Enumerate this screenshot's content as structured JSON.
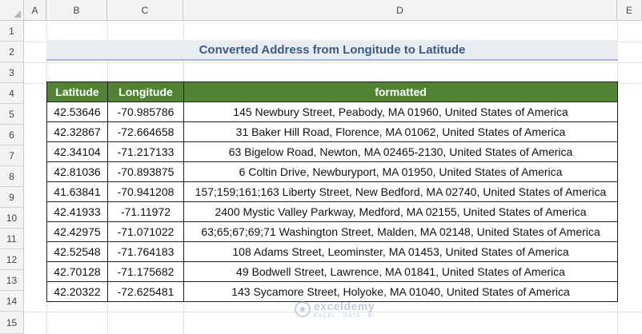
{
  "columns": [
    "A",
    "B",
    "C",
    "D",
    "E"
  ],
  "rows": [
    "1",
    "2",
    "3",
    "4",
    "5",
    "6",
    "7",
    "8",
    "9",
    "10",
    "11",
    "12",
    "13",
    "14",
    "15"
  ],
  "title": "Converted Address from Longitude to Latitude",
  "table": {
    "headers": [
      "Latitude",
      "Longitude",
      "formatted"
    ],
    "rows": [
      [
        "42.53646",
        "-70.985786",
        "145 Newbury Street, Peabody, MA 01960, United States of America"
      ],
      [
        "42.32867",
        "-72.664658",
        "31 Baker Hill Road, Florence, MA 01062, United States of America"
      ],
      [
        "42.34104",
        "-71.217133",
        "63 Bigelow Road, Newton, MA 02465-2130, United States of America"
      ],
      [
        "42.81036",
        "-70.893875",
        "6 Coltin Drive, Newburyport, MA 01950, United States of America"
      ],
      [
        "41.63841",
        "-70.941208",
        "157;159;161;163 Liberty Street, New Bedford, MA 02740, United States of America"
      ],
      [
        "42.41933",
        "-71.11972",
        "2400 Mystic Valley Parkway, Medford, MA 02155, United States of America"
      ],
      [
        "42.42975",
        "-71.071022",
        "63;65;67;69;71 Washington Street, Malden, MA 02148, United States of America"
      ],
      [
        "42.52548",
        "-71.764183",
        "108 Adams Street, Leominster, MA 01453, United States of America"
      ],
      [
        "42.70128",
        "-71.175682",
        "49 Bodwell Street, Lawrence, MA 01841, United States of America"
      ],
      [
        "42.20322",
        "-72.625481",
        "143 Sycamore Street, Holyoke, MA 01040, United States of America"
      ]
    ]
  },
  "watermark": {
    "name": "exceldemy",
    "tagline": "EXCEL · DATA · BI"
  }
}
